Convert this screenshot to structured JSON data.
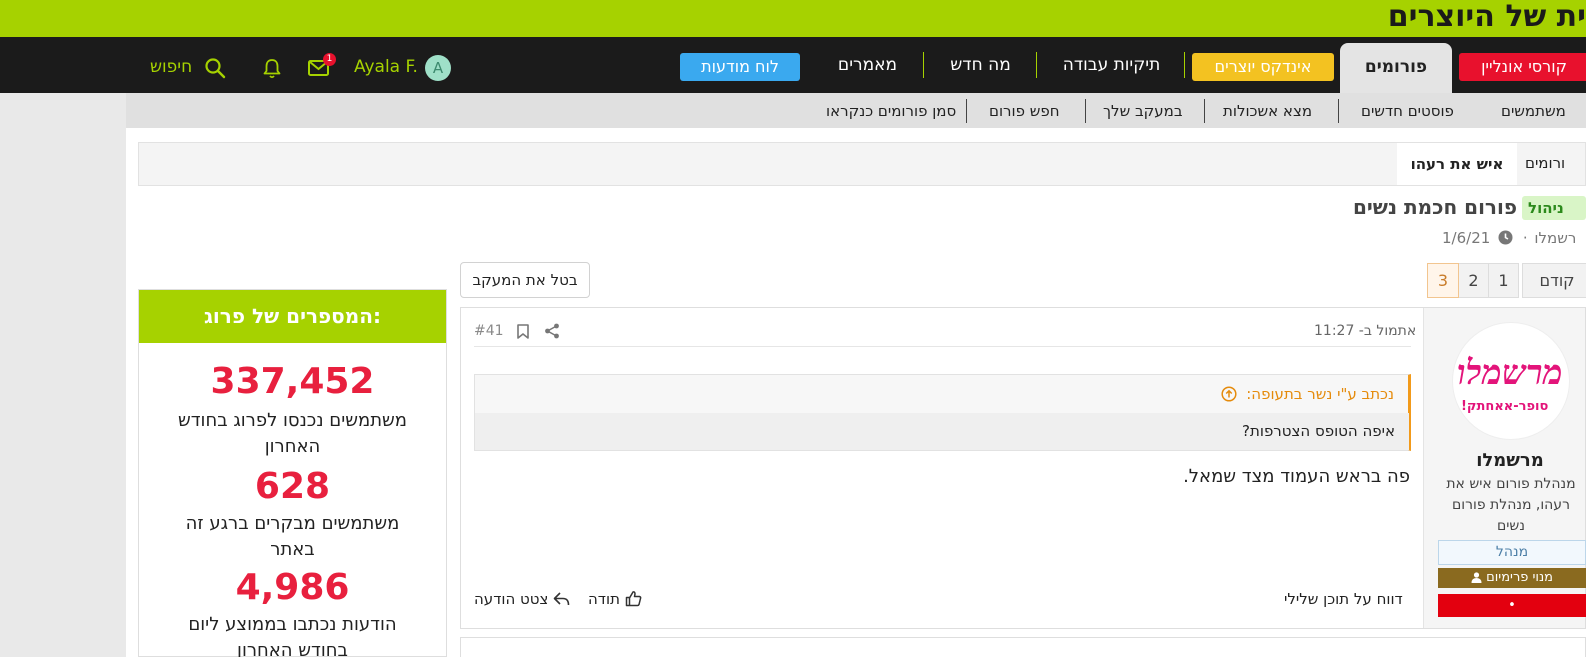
{
  "site": {
    "logo_text": "ית של היוצרים"
  },
  "nav": {
    "tabs": {
      "courses": "קורסי אונליין",
      "forums": "פורומים",
      "creators_index": "אינדקס יוצרים",
      "portfolios": "תיקיות עבודה",
      "whats_new": "מה חדש",
      "articles": "מאמרים",
      "message_board": "לוח מודעות"
    },
    "user": {
      "name": "Ayala F.",
      "avatar_letter": "A"
    },
    "mail_count": "1",
    "search_label": "חיפוש"
  },
  "subnav": {
    "items": [
      "משתמשים",
      "פוסטים חדשים",
      "מצא אשכולות",
      "במעקב שלך",
      "חפש פורום",
      "סמן פורומים כנקראו"
    ]
  },
  "breadcrumb": {
    "parent": "ורומים",
    "current": "איש את רעהו"
  },
  "thread": {
    "tag": "ניהול",
    "title": "פורום חכמת נשים",
    "author": "רשמלו",
    "date": "1/6/21"
  },
  "pagination": {
    "prev": "קודם",
    "pages": [
      "1",
      "2",
      "3"
    ],
    "current": "3"
  },
  "unwatch_label": "בטל את המעקב",
  "widget": {
    "title": "המספרים של פרוג:",
    "stats": [
      {
        "value": "337,452",
        "label": "משתמשים נכנסו לפרוג בחודש האחרון"
      },
      {
        "value": "628",
        "label": "משתמשים מבקרים ברגע זה באתר"
      },
      {
        "value": "4,986",
        "label": "הודעות נכתבו בממוצע ליום בחודש האחרון"
      }
    ]
  },
  "post": {
    "time": "אתמול ב- 11:27",
    "number": "#41",
    "quote_header": "נכתב ע\"י נשר בתעופה:",
    "quote_text": "איפה הטופס הצטרפות?",
    "body": "פה בראש העמוד מצד שמאל.",
    "report": "דווח על תוכן שלילי",
    "like": "תודה",
    "reply": "צטט הודעה",
    "user": {
      "name": "מרשמלו",
      "title": "מנהלת פורום איש את רעהו, מנהלת פורום נשים",
      "role_badge": "מנהל",
      "premium_badge": "מנוי פרימיום",
      "red_badge": "•",
      "avatar_logo": "מרשמלו",
      "avatar_sub": "סופר-אאחתק!"
    }
  },
  "colors": {
    "brand_green": "#a6d200",
    "nav_dark": "#1b1b1b",
    "stat_red": "#e8203e",
    "quote_orange": "#f29a1a"
  }
}
